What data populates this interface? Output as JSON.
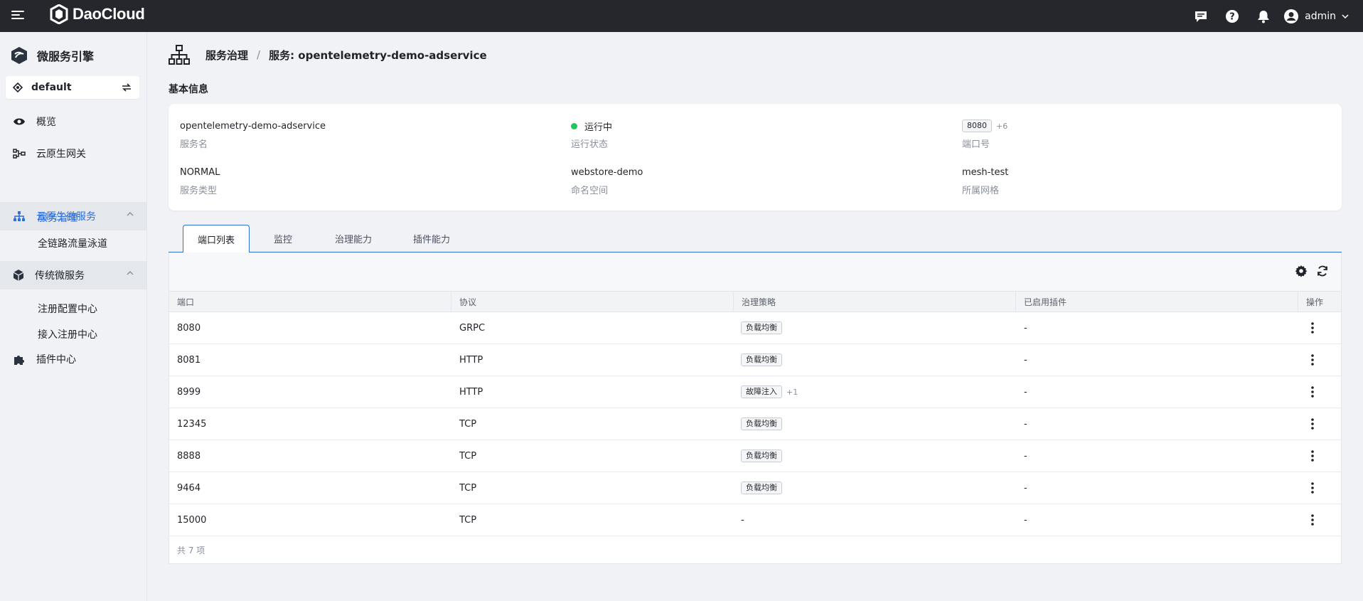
{
  "topbar": {
    "brand": "DaoCloud",
    "user_name": "admin",
    "icons": [
      "message-icon",
      "help-icon",
      "bell-icon",
      "user-avatar-icon"
    ]
  },
  "sidebar": {
    "title": "微服务引擎",
    "workspace": "default",
    "items": [
      {
        "label": "概览",
        "icon": "eye-icon"
      },
      {
        "label": "云原生网关",
        "icon": "gateway-icon"
      },
      {
        "label": "云原生微服务",
        "icon": "sitemap-icon"
      },
      {
        "label": "传统微服务",
        "icon": "cube-icon"
      },
      {
        "label": "插件中心",
        "icon": "puzzle-icon"
      }
    ],
    "cloud_sub": [
      "服务治理",
      "全链路流量泳道"
    ],
    "traditional_sub": [
      "注册配置中心",
      "接入注册中心"
    ]
  },
  "breadcrumb": {
    "root": "服务治理",
    "separator": "/",
    "current": "服务: opentelemetry-demo-adservice"
  },
  "basic_info": {
    "title": "基本信息",
    "service_name": "opentelemetry-demo-adservice",
    "service_name_label": "服务名",
    "status": "运行中",
    "status_label": "运行状态",
    "port_tag": "8080",
    "port_more": "+6",
    "port_label": "端口号",
    "service_type": "NORMAL",
    "service_type_label": "服务类型",
    "namespace": "webstore-demo",
    "namespace_label": "命名空间",
    "mesh": "mesh-test",
    "mesh_label": "所属网格",
    "status_color": "#21c45d"
  },
  "tabs": [
    "端口列表",
    "监控",
    "治理能力",
    "插件能力"
  ],
  "table": {
    "columns": [
      "端口",
      "协议",
      "治理策略",
      "已启用插件",
      "操作"
    ],
    "rows": [
      {
        "port": "8080",
        "protocol": "GRPC",
        "policy": "负载均衡",
        "policy_more": "",
        "plugins": "-"
      },
      {
        "port": "8081",
        "protocol": "HTTP",
        "policy": "负载均衡",
        "policy_more": "",
        "plugins": "-"
      },
      {
        "port": "8999",
        "protocol": "HTTP",
        "policy": "故障注入",
        "policy_more": "+1",
        "plugins": "-"
      },
      {
        "port": "12345",
        "protocol": "TCP",
        "policy": "负载均衡",
        "policy_more": "",
        "plugins": "-"
      },
      {
        "port": "8888",
        "protocol": "TCP",
        "policy": "负载均衡",
        "policy_more": "",
        "plugins": "-"
      },
      {
        "port": "9464",
        "protocol": "TCP",
        "policy": "负载均衡",
        "policy_more": "",
        "plugins": "-"
      },
      {
        "port": "15000",
        "protocol": "TCP",
        "policy": "",
        "policy_text": "-",
        "policy_more": "",
        "plugins": "-"
      }
    ],
    "footer": "共 7 项"
  },
  "colors": {
    "accent": "#2e6fd8",
    "topbar": "#25272c"
  }
}
